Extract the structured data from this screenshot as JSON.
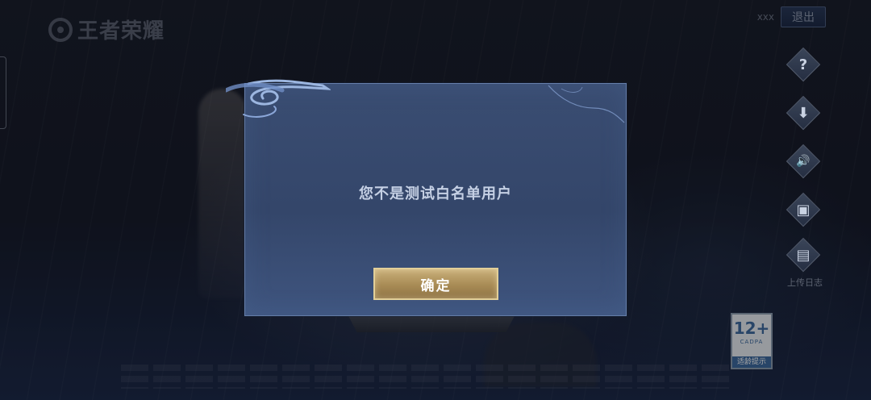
{
  "background": {
    "logo_text": "王者荣耀"
  },
  "header": {
    "username": "xxx",
    "logout_label": "退出"
  },
  "side_menu": {
    "items": [
      {
        "icon": "help-icon",
        "glyph": "?"
      },
      {
        "icon": "download-icon",
        "glyph": "⬇"
      },
      {
        "icon": "sound-icon",
        "glyph": "🔊"
      },
      {
        "icon": "card-icon",
        "glyph": "▣"
      },
      {
        "icon": "upload-log-icon",
        "glyph": "▤",
        "label": "上传日志"
      }
    ]
  },
  "age_rating": {
    "age": "12+",
    "org": "CADPA",
    "caption": "适龄提示"
  },
  "dialog": {
    "message": "您不是测试白名单用户",
    "confirm_label": "确定"
  },
  "colors": {
    "dialog_bg": "#34466a",
    "button_gold": "#a88b55",
    "message_text": "#c5d0e4"
  }
}
